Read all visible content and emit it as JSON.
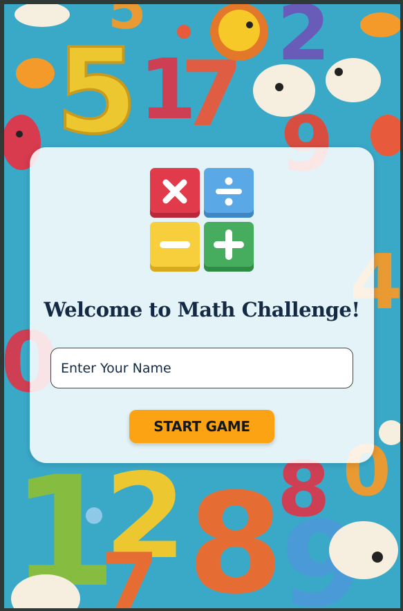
{
  "app": {
    "title": "Welcome to Math Challenge!"
  },
  "logo": {
    "icons": [
      "multiply-icon",
      "divide-icon",
      "minus-icon",
      "plus-icon"
    ],
    "colors": {
      "multiply": "#e03a4b",
      "divide": "#5aa8e6",
      "minus": "#f7cf3c",
      "plus": "#47ad5e"
    }
  },
  "form": {
    "name_placeholder": "Enter Your Name",
    "start_label": "START GAME"
  },
  "theme": {
    "accent": "#fba312",
    "text": "#142a44",
    "background": "#3aa9c8"
  }
}
